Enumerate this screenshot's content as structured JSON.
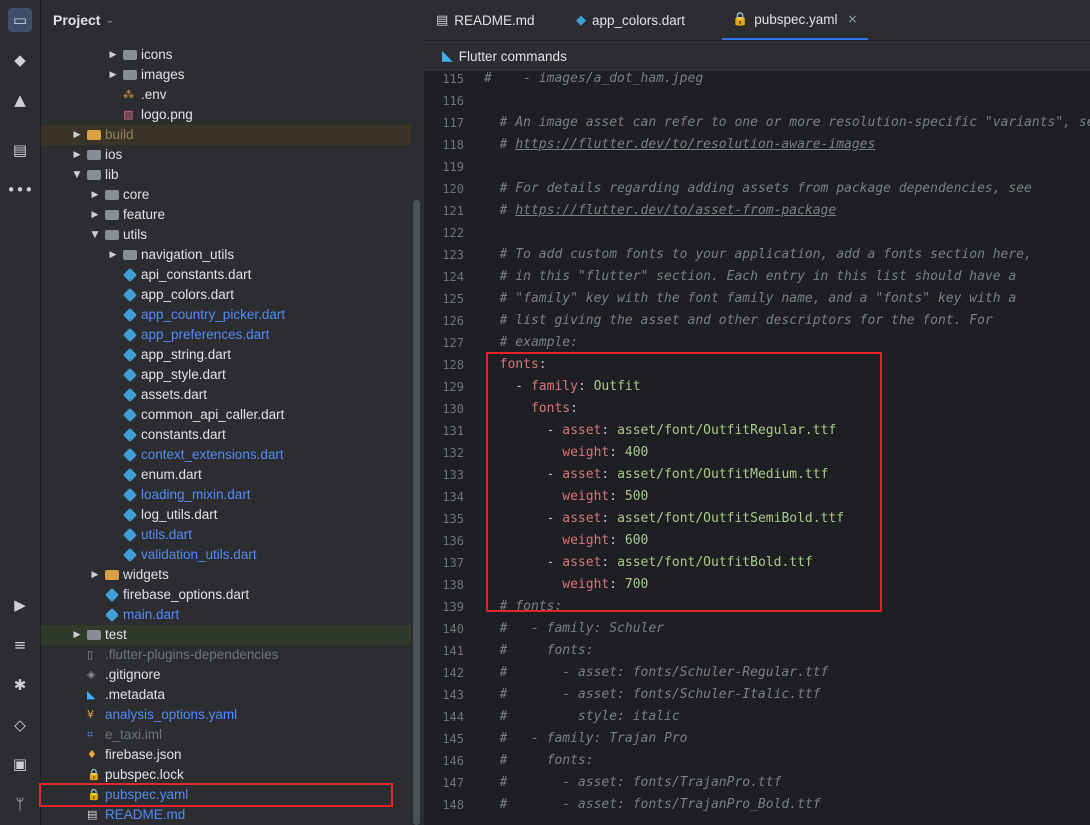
{
  "activity_bar": {
    "items": [
      {
        "name": "project-icon",
        "glyph": "▭",
        "active": true
      },
      {
        "name": "commit-icon",
        "glyph": "◆"
      },
      {
        "name": "structure-icon",
        "glyph": "▲"
      },
      {
        "name": "layers-icon",
        "glyph": "▤"
      },
      {
        "name": "more-icon",
        "glyph": "•••"
      }
    ],
    "bottom_items": [
      {
        "name": "run-icon",
        "glyph": "▶"
      },
      {
        "name": "list-icon",
        "glyph": "≡"
      },
      {
        "name": "debug-icon",
        "glyph": "✱"
      },
      {
        "name": "gem-icon",
        "glyph": "◇"
      },
      {
        "name": "terminal-icon",
        "glyph": "▣"
      },
      {
        "name": "git-icon",
        "glyph": "ᛘ"
      }
    ]
  },
  "project": {
    "title": "Project",
    "tree": [
      {
        "label": "icons",
        "depth": 3,
        "arrow": "▶",
        "icon": "folder",
        "color": "norm"
      },
      {
        "label": "images",
        "depth": 3,
        "arrow": "▶",
        "icon": "folder",
        "color": "norm"
      },
      {
        "label": ".env",
        "depth": 3,
        "arrow": "",
        "icon": "env",
        "color": "norm"
      },
      {
        "label": "logo.png",
        "depth": 3,
        "arrow": "",
        "icon": "image",
        "color": "norm"
      },
      {
        "label": "build",
        "depth": 1,
        "arrow": "▶",
        "icon": "folder-y",
        "color": "ign",
        "bg": "build"
      },
      {
        "label": "ios",
        "depth": 1,
        "arrow": "▶",
        "icon": "folder",
        "color": "norm"
      },
      {
        "label": "lib",
        "depth": 1,
        "arrow": "▼",
        "icon": "folder",
        "color": "norm"
      },
      {
        "label": "core",
        "depth": 2,
        "arrow": "▶",
        "icon": "folder",
        "color": "norm"
      },
      {
        "label": "feature",
        "depth": 2,
        "arrow": "▶",
        "icon": "folder",
        "color": "norm"
      },
      {
        "label": "utils",
        "depth": 2,
        "arrow": "▼",
        "icon": "folder",
        "color": "norm"
      },
      {
        "label": "navigation_utils",
        "depth": 3,
        "arrow": "▶",
        "icon": "folder",
        "color": "norm"
      },
      {
        "label": "api_constants.dart",
        "depth": 3,
        "arrow": "",
        "icon": "dart",
        "color": "norm"
      },
      {
        "label": "app_colors.dart",
        "depth": 3,
        "arrow": "",
        "icon": "dart",
        "color": "norm"
      },
      {
        "label": "app_country_picker.dart",
        "depth": 3,
        "arrow": "",
        "icon": "dart",
        "color": "blue"
      },
      {
        "label": "app_preferences.dart",
        "depth": 3,
        "arrow": "",
        "icon": "dart",
        "color": "blue"
      },
      {
        "label": "app_string.dart",
        "depth": 3,
        "arrow": "",
        "icon": "dart",
        "color": "norm"
      },
      {
        "label": "app_style.dart",
        "depth": 3,
        "arrow": "",
        "icon": "dart",
        "color": "norm"
      },
      {
        "label": "assets.dart",
        "depth": 3,
        "arrow": "",
        "icon": "dart",
        "color": "norm"
      },
      {
        "label": "common_api_caller.dart",
        "depth": 3,
        "arrow": "",
        "icon": "dart",
        "color": "norm"
      },
      {
        "label": "constants.dart",
        "depth": 3,
        "arrow": "",
        "icon": "dart",
        "color": "norm"
      },
      {
        "label": "context_extensions.dart",
        "depth": 3,
        "arrow": "",
        "icon": "dart",
        "color": "blue"
      },
      {
        "label": "enum.dart",
        "depth": 3,
        "arrow": "",
        "icon": "dart",
        "color": "norm"
      },
      {
        "label": "loading_mixin.dart",
        "depth": 3,
        "arrow": "",
        "icon": "dart",
        "color": "blue"
      },
      {
        "label": "log_utils.dart",
        "depth": 3,
        "arrow": "",
        "icon": "dart",
        "color": "norm"
      },
      {
        "label": "utils.dart",
        "depth": 3,
        "arrow": "",
        "icon": "dart",
        "color": "blue"
      },
      {
        "label": "validation_utils.dart",
        "depth": 3,
        "arrow": "",
        "icon": "dart",
        "color": "blue"
      },
      {
        "label": "widgets",
        "depth": 2,
        "arrow": "▶",
        "icon": "folder-y",
        "color": "norm"
      },
      {
        "label": "firebase_options.dart",
        "depth": 2,
        "arrow": "",
        "icon": "dart",
        "color": "norm"
      },
      {
        "label": "main.dart",
        "depth": 2,
        "arrow": "",
        "icon": "dart",
        "color": "blue"
      },
      {
        "label": "test",
        "depth": 1,
        "arrow": "▶",
        "icon": "folder",
        "color": "norm",
        "bg": "test"
      },
      {
        "label": ".flutter-plugins-dependencies",
        "depth": 1,
        "arrow": "",
        "icon": "file",
        "color": "dim"
      },
      {
        "label": ".gitignore",
        "depth": 1,
        "arrow": "",
        "icon": "gitignore",
        "color": "norm"
      },
      {
        "label": ".metadata",
        "depth": 1,
        "arrow": "",
        "icon": "flutter",
        "color": "norm"
      },
      {
        "label": "analysis_options.yaml",
        "depth": 1,
        "arrow": "",
        "icon": "yaml",
        "color": "blue"
      },
      {
        "label": "e_taxi.iml",
        "depth": 1,
        "arrow": "",
        "icon": "iml",
        "color": "dim"
      },
      {
        "label": "firebase.json",
        "depth": 1,
        "arrow": "",
        "icon": "firebase",
        "color": "norm"
      },
      {
        "label": "pubspec.lock",
        "depth": 1,
        "arrow": "",
        "icon": "lock",
        "color": "norm"
      },
      {
        "label": "pubspec.yaml",
        "depth": 1,
        "arrow": "",
        "icon": "lock",
        "color": "blue",
        "selected": true
      },
      {
        "label": "README.md",
        "depth": 1,
        "arrow": "",
        "icon": "md",
        "color": "blue"
      }
    ]
  },
  "tabs": [
    {
      "label": "README.md",
      "icon": "md",
      "active": false
    },
    {
      "label": "app_colors.dart",
      "icon": "dart",
      "active": false
    },
    {
      "label": "pubspec.yaml",
      "icon": "lock",
      "active": true,
      "close": "×"
    }
  ],
  "flutter_bar": {
    "label": "Flutter commands"
  },
  "editor": {
    "lines": [
      {
        "n": "115",
        "segs": [
          {
            "t": "#    - images/a_dot_ham.jpeg",
            "c": "cm"
          }
        ]
      },
      {
        "n": "116",
        "segs": []
      },
      {
        "n": "117",
        "segs": [
          {
            "t": "  # An image asset can refer to one or more resolution-specific \"variants\", see",
            "c": "cm"
          }
        ]
      },
      {
        "n": "118",
        "segs": [
          {
            "t": "  # ",
            "c": "cm"
          },
          {
            "t": "https://flutter.dev/to/resolution-aware-images",
            "c": "link"
          }
        ]
      },
      {
        "n": "119",
        "segs": []
      },
      {
        "n": "120",
        "segs": [
          {
            "t": "  # For details regarding adding assets from package dependencies, see",
            "c": "cm"
          }
        ]
      },
      {
        "n": "121",
        "segs": [
          {
            "t": "  # ",
            "c": "cm"
          },
          {
            "t": "https://flutter.dev/to/asset-from-package",
            "c": "link"
          }
        ]
      },
      {
        "n": "122",
        "segs": []
      },
      {
        "n": "123",
        "segs": [
          {
            "t": "  # To add custom fonts to your application, add a fonts section here,",
            "c": "cm"
          }
        ]
      },
      {
        "n": "124",
        "segs": [
          {
            "t": "  # in this \"flutter\" section. Each entry in this list should have a",
            "c": "cm"
          }
        ]
      },
      {
        "n": "125",
        "segs": [
          {
            "t": "  # \"family\" key with the font family name, and a \"fonts\" key with a",
            "c": "cm"
          }
        ]
      },
      {
        "n": "126",
        "segs": [
          {
            "t": "  # list giving the asset and other descriptors for the font. For",
            "c": "cm"
          }
        ]
      },
      {
        "n": "127",
        "segs": [
          {
            "t": "  # example:",
            "c": "cm"
          }
        ]
      },
      {
        "n": "128",
        "segs": [
          {
            "t": "  fonts",
            "c": "key"
          },
          {
            "t": ":",
            "c": "punc"
          }
        ]
      },
      {
        "n": "129",
        "segs": [
          {
            "t": "    - ",
            "c": "punc"
          },
          {
            "t": "family",
            "c": "key"
          },
          {
            "t": ": ",
            "c": "punc"
          },
          {
            "t": "Outfit",
            "c": "val"
          }
        ]
      },
      {
        "n": "130",
        "segs": [
          {
            "t": "      fonts",
            "c": "key"
          },
          {
            "t": ":",
            "c": "punc"
          }
        ]
      },
      {
        "n": "131",
        "segs": [
          {
            "t": "        - ",
            "c": "punc"
          },
          {
            "t": "asset",
            "c": "key"
          },
          {
            "t": ": ",
            "c": "punc"
          },
          {
            "t": "asset/font/OutfitRegular.ttf",
            "c": "val"
          }
        ]
      },
      {
        "n": "132",
        "segs": [
          {
            "t": "          weight",
            "c": "key"
          },
          {
            "t": ": ",
            "c": "punc"
          },
          {
            "t": "400",
            "c": "val"
          }
        ]
      },
      {
        "n": "133",
        "segs": [
          {
            "t": "        - ",
            "c": "punc"
          },
          {
            "t": "asset",
            "c": "key"
          },
          {
            "t": ": ",
            "c": "punc"
          },
          {
            "t": "asset/font/OutfitMedium.ttf",
            "c": "val"
          }
        ]
      },
      {
        "n": "134",
        "segs": [
          {
            "t": "          weight",
            "c": "key"
          },
          {
            "t": ": ",
            "c": "punc"
          },
          {
            "t": "500",
            "c": "val"
          }
        ]
      },
      {
        "n": "135",
        "segs": [
          {
            "t": "        - ",
            "c": "punc"
          },
          {
            "t": "asset",
            "c": "key"
          },
          {
            "t": ": ",
            "c": "punc"
          },
          {
            "t": "asset/font/OutfitSemiBold.ttf",
            "c": "val"
          }
        ]
      },
      {
        "n": "136",
        "segs": [
          {
            "t": "          weight",
            "c": "key"
          },
          {
            "t": ": ",
            "c": "punc"
          },
          {
            "t": "600",
            "c": "val"
          }
        ]
      },
      {
        "n": "137",
        "segs": [
          {
            "t": "        - ",
            "c": "punc"
          },
          {
            "t": "asset",
            "c": "key"
          },
          {
            "t": ": ",
            "c": "punc"
          },
          {
            "t": "asset/font/OutfitBold.ttf",
            "c": "val"
          }
        ]
      },
      {
        "n": "138",
        "segs": [
          {
            "t": "          weight",
            "c": "key"
          },
          {
            "t": ": ",
            "c": "punc"
          },
          {
            "t": "700",
            "c": "val"
          }
        ]
      },
      {
        "n": "139",
        "segs": [
          {
            "t": "  # fonts:",
            "c": "cm"
          }
        ]
      },
      {
        "n": "140",
        "segs": [
          {
            "t": "  #   - family: Schuler",
            "c": "cm"
          }
        ]
      },
      {
        "n": "141",
        "segs": [
          {
            "t": "  #     fonts:",
            "c": "cm"
          }
        ]
      },
      {
        "n": "142",
        "segs": [
          {
            "t": "  #       - asset: fonts/Schuler-Regular.ttf",
            "c": "cm"
          }
        ]
      },
      {
        "n": "143",
        "segs": [
          {
            "t": "  #       - asset: fonts/Schuler-Italic.ttf",
            "c": "cm"
          }
        ]
      },
      {
        "n": "144",
        "segs": [
          {
            "t": "  #         style: italic",
            "c": "cm"
          }
        ]
      },
      {
        "n": "145",
        "segs": [
          {
            "t": "  #   - family: Trajan Pro",
            "c": "cm"
          }
        ]
      },
      {
        "n": "146",
        "segs": [
          {
            "t": "  #     fonts:",
            "c": "cm"
          }
        ]
      },
      {
        "n": "147",
        "segs": [
          {
            "t": "  #       - asset: fonts/TrajanPro.ttf",
            "c": "cm"
          }
        ]
      },
      {
        "n": "148",
        "segs": [
          {
            "t": "  #       - asset: fonts/TrajanPro_Bold.ttf",
            "c": "cm"
          }
        ]
      }
    ]
  }
}
